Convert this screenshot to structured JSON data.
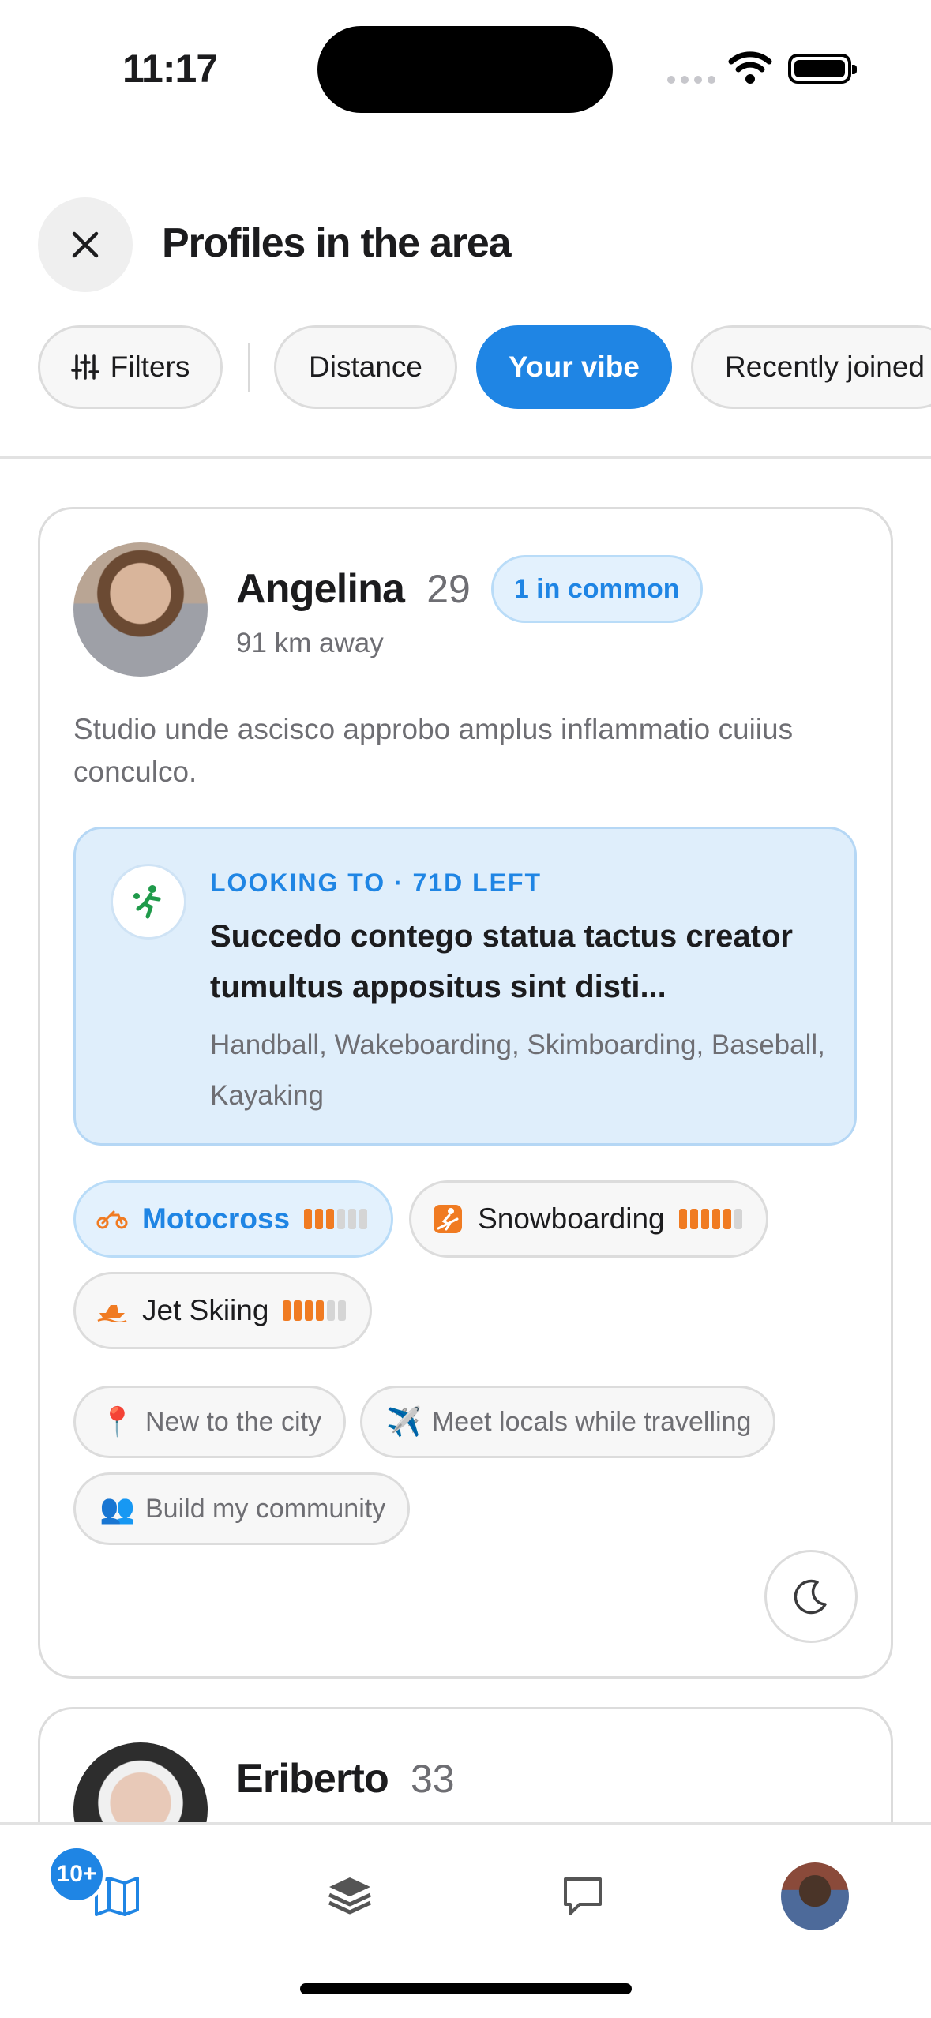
{
  "status_bar": {
    "time": "11:17"
  },
  "header": {
    "title": "Profiles in the area"
  },
  "filters": {
    "filters_label": "Filters",
    "sort_options": [
      "Distance",
      "Your vibe",
      "Recently joined"
    ],
    "selected": "Your vibe"
  },
  "profiles": [
    {
      "name": "Angelina",
      "age": "29",
      "common_badge": "1 in common",
      "distance": "91 km away",
      "bio": "Studio unde ascisco approbo amplus inflammatio cuiius conculco.",
      "looking": {
        "kicker": "LOOKING TO · 71D LEFT",
        "title": "Succedo contego statua tactus creator tumultus appositus sint disti...",
        "sports": "Handball, Wakeboarding, Skimboarding, Baseball, Kayaking"
      },
      "activities": [
        {
          "label": "Motocross",
          "icon": "motorbike-icon",
          "level": 3,
          "max": 6,
          "highlight": true
        },
        {
          "label": "Snowboarding",
          "icon": "snowboard-icon",
          "level": 5,
          "max": 6
        },
        {
          "label": "Jet Skiing",
          "icon": "jetski-icon",
          "level": 4,
          "max": 6
        }
      ],
      "tags": [
        {
          "emoji": "📍",
          "label": "New to the city"
        },
        {
          "emoji": "✈️",
          "label": "Meet locals while travelling"
        },
        {
          "emoji": "👥",
          "label": "Build my community"
        }
      ]
    },
    {
      "name": "Eriberto",
      "age": "33"
    }
  ],
  "tab_bar": {
    "map_badge": "10+"
  },
  "colors": {
    "accent": "#1f85e4",
    "level": "#f07b22"
  }
}
